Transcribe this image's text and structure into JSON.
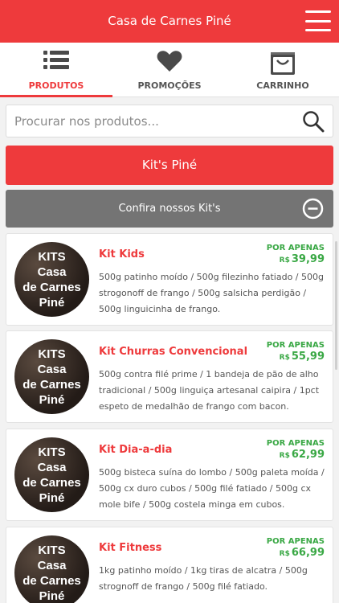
{
  "header": {
    "title": "Casa de Carnes Piné"
  },
  "tabs": [
    {
      "label": "PRODUTOS",
      "icon": "list-icon"
    },
    {
      "label": "PROMOÇÕES",
      "icon": "heart-icon"
    },
    {
      "label": "CARRINHO",
      "icon": "bag-icon"
    }
  ],
  "search": {
    "placeholder": "Procurar nos produtos..."
  },
  "kits_button": {
    "label": "Kit's Piné"
  },
  "section": {
    "title": "Confira nossos Kit's"
  },
  "products": [
    {
      "thumb_text": [
        "KITS",
        "Casa",
        "de Carnes",
        "Piné"
      ],
      "name": "Kit Kids",
      "price_label": "POR APENAS",
      "currency": "R$",
      "price": "39,99",
      "description": "500g patinho moído / 500g filezinho fatiado / 500g strogonoff de frango / 500g salsicha perdigão / 500g linguicinha de frango."
    },
    {
      "thumb_text": [
        "KITS",
        "Casa",
        "de Carnes",
        "Piné"
      ],
      "name": "Kit Churras Convencional",
      "price_label": "POR APENAS",
      "currency": "R$",
      "price": "55,99",
      "description": "500g contra filé prime / 1 bandeja de pão de alho tradicional / 500g linguiça artesanal caipira / 1pct espeto de medalhão de frango com bacon."
    },
    {
      "thumb_text": [
        "KITS",
        "Casa",
        "de Carnes",
        "Piné"
      ],
      "name": "Kit Dia-a-dia",
      "price_label": "POR APENAS",
      "currency": "R$",
      "price": "62,99",
      "description": "500g bisteca suína do lombo / 500g paleta moída / 500g cx duro cubos / 500g filé fatiado / 500g cx mole bife / 500g costela minga em cubos."
    },
    {
      "thumb_text": [
        "KITS",
        "Casa",
        "de Carnes",
        "Piné"
      ],
      "name": "Kit Fitness",
      "price_label": "POR APENAS",
      "currency": "R$",
      "price": "66,99",
      "description": "1kg patinho moído / 1kg tiras de alcatra / 500g strognoff de frango / 500g filé fatiado."
    }
  ],
  "colors": {
    "brand": "#ee3a3c",
    "price": "#3aa845",
    "section": "#747474"
  }
}
